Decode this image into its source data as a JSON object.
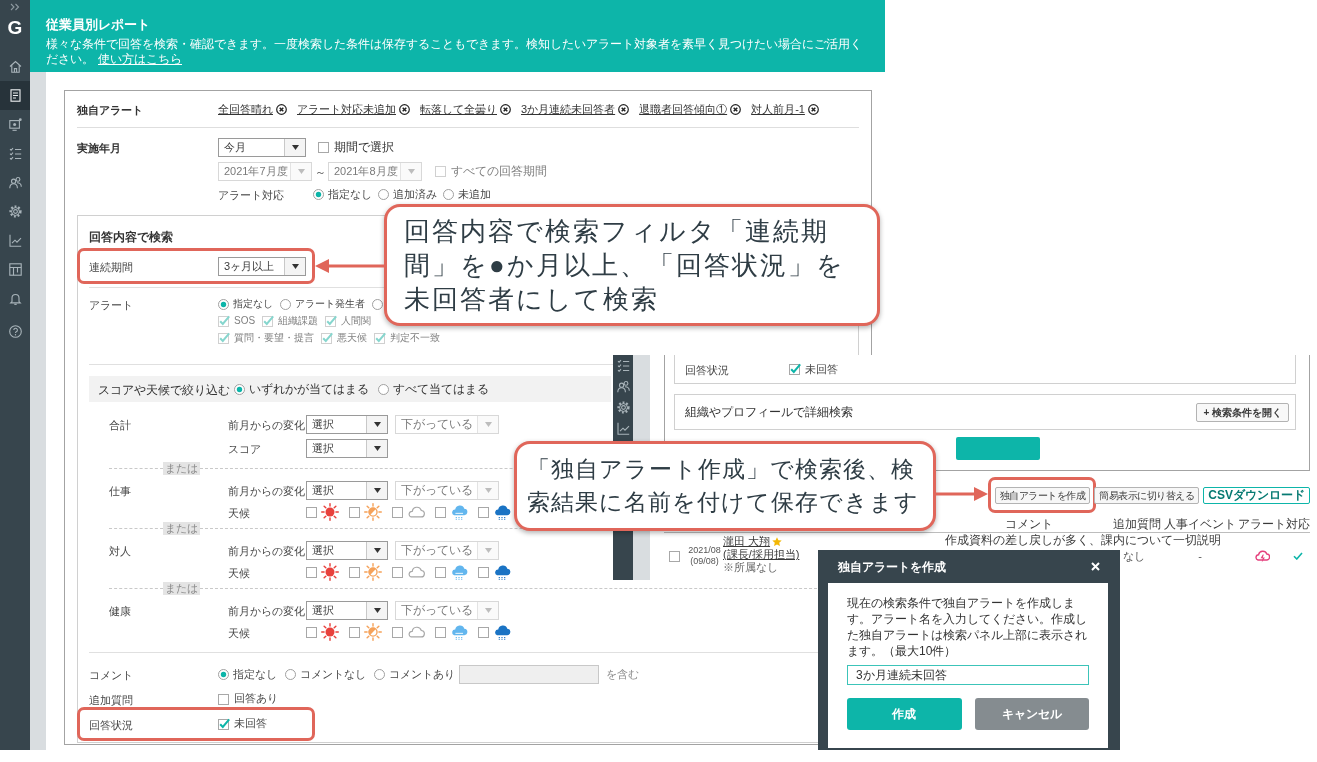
{
  "sidebar": {
    "logo": "G",
    "items": [
      {
        "selected": false
      },
      {
        "selected": true
      },
      {
        "selected": false
      },
      {
        "selected": false
      },
      {
        "selected": false
      },
      {
        "selected": false
      },
      {
        "selected": false
      },
      {
        "selected": false
      },
      {
        "selected": false
      },
      {
        "selected": false
      }
    ]
  },
  "header": {
    "title": "従業員別レポート",
    "description": "様々な条件で回答を検索・確認できます。一度検索した条件は保存することもできます。検知したいアラート対象者を素早く見つけたい場合にご活用ください。",
    "help_link": "使い方はこちら"
  },
  "filters": {
    "custom_alerts": {
      "label": "独自アラート",
      "items": [
        "全回答晴れ",
        "アラート対応未追加",
        "転落して全曇り",
        "3か月連続未回答者",
        "退職者回答傾向①",
        "対人前月-1"
      ]
    },
    "period": {
      "label": "実施年月",
      "month": {
        "value": "今月",
        "disabled": false
      },
      "range": {
        "label": "期間で選択",
        "checked": false,
        "disabled": false
      },
      "from": {
        "value": "2021年7月度",
        "disabled": true
      },
      "separator": "～",
      "to": {
        "value": "2021年8月度",
        "disabled": true
      },
      "all": {
        "label": "すべての回答期間",
        "checked": false,
        "disabled": true
      },
      "alert_action": {
        "label": "アラート対応",
        "options": [
          {
            "label": "指定なし",
            "selected": true
          },
          {
            "label": "追加済み",
            "selected": false
          },
          {
            "label": "未追加",
            "selected": false
          }
        ]
      }
    },
    "answer_search": {
      "title": "回答内容で検索",
      "streak": {
        "label": "連続期間",
        "value": "3ヶ月以上",
        "highlighted": true
      },
      "alert": {
        "label": "アラート",
        "options": [
          {
            "label": "指定なし",
            "selected": true
          },
          {
            "label": "アラート発生者",
            "selected": false
          },
          {
            "selected": false
          }
        ],
        "types": [
          [
            {
              "label": "SOS",
              "checked": true,
              "disabled": true
            },
            {
              "label": "組織課題",
              "checked": true,
              "disabled": true
            },
            {
              "label": "人間関",
              "checked": true,
              "disabled": true
            }
          ],
          [
            {
              "label": "質問・要望・提言",
              "checked": true,
              "disabled": true
            },
            {
              "label": "悪天候",
              "checked": true,
              "disabled": true
            },
            {
              "label": "判定不一致",
              "checked": true,
              "disabled": true
            }
          ]
        ]
      },
      "score": {
        "label": "スコアや天候で絞り込む",
        "options": [
          {
            "label": "いずれかが当てはまる",
            "selected": true
          },
          {
            "label": "すべて当てはまる",
            "selected": false
          }
        ]
      },
      "categories": [
        {
          "name": "合計",
          "rows": [
            {
              "kind": "change",
              "label": "前月からの変化",
              "value": "選択",
              "direction": {
                "value": "下がっている",
                "disabled": true
              }
            },
            {
              "kind": "score",
              "label": "スコア",
              "value": "選択"
            }
          ]
        },
        {
          "separator": "または",
          "name": "仕事",
          "rows": [
            {
              "kind": "change",
              "label": "前月からの変化",
              "value": "選択",
              "direction": {
                "value": "下がっている",
                "disabled": true
              }
            },
            {
              "kind": "weather",
              "label": "天候",
              "options": [
                {
                  "checked": false
                },
                {
                  "checked": false
                },
                {
                  "checked": false
                },
                {
                  "checked": false
                },
                {
                  "checked": false
                }
              ]
            }
          ]
        },
        {
          "separator": "または",
          "name": "対人",
          "rows": [
            {
              "kind": "change",
              "label": "前月からの変化",
              "value": "選択",
              "direction": {
                "value": "下がっている",
                "disabled": true
              }
            },
            {
              "kind": "weather",
              "label": "天候",
              "options": [
                {
                  "checked": false
                },
                {
                  "checked": false
                },
                {
                  "checked": false
                },
                {
                  "checked": false
                },
                {
                  "checked": false
                }
              ]
            }
          ]
        },
        {
          "separator": "または",
          "name": "健康",
          "rows": [
            {
              "kind": "change",
              "label": "前月からの変化",
              "value": "選択",
              "direction": {
                "value": "下がっている",
                "disabled": true
              }
            },
            {
              "kind": "weather",
              "label": "天候",
              "options": [
                {
                  "checked": false
                },
                {
                  "checked": false
                },
                {
                  "checked": false
                },
                {
                  "checked": false
                },
                {
                  "checked": false
                }
              ]
            }
          ]
        }
      ],
      "comment": {
        "label": "コメント",
        "options": [
          {
            "label": "指定なし",
            "selected": true
          },
          {
            "label": "コメントなし",
            "selected": false
          },
          {
            "label": "コメントあり",
            "selected": false
          }
        ],
        "input": {
          "disabled": true
        },
        "suffix": "を含む"
      },
      "extra_question": {
        "label": "追加質問",
        "check": {
          "label": "回答あり",
          "checked": false
        }
      },
      "status": {
        "label": "回答状況",
        "check": {
          "label": "未回答",
          "checked": true
        },
        "highlighted": true
      }
    }
  },
  "results_screen": {
    "sidebar_items": [
      {
        "selected": false
      },
      {
        "selected": false
      },
      {
        "selected": false
      },
      {
        "selected": false
      }
    ],
    "answer_status": {
      "label": "回答状況",
      "check": {
        "label": "未回答",
        "checked": true
      }
    },
    "detail_search": {
      "label": "組織やプロフィールで詳細検索",
      "button": "+ 検索条件を開く"
    },
    "search_button": {
      "kind": "primary"
    },
    "actions": [
      {
        "label": "独自アラートを作成",
        "kind": "plain",
        "highlighted": true
      },
      {
        "label": "簡易表示に切り替える",
        "kind": "plain",
        "highlighted": false
      },
      {
        "label": "CSVダウンロード",
        "kind": "accent",
        "highlighted": false
      }
    ],
    "columns": [
      "コメント",
      "追加質問",
      "人事イベント",
      "アラート",
      "対応"
    ],
    "rows": [
      {
        "checked": false,
        "date": "2021/08",
        "date_note": "(09/08)",
        "name": "瀧田 大翔",
        "starred": true,
        "role": "(課長/採用担当)",
        "department": "※所属なし",
        "comment": "作成資料の差し戻しが多く、課内について一切説明",
        "extra": "なし",
        "hr_event": "-",
        "alert": true,
        "handled": true
      }
    ]
  },
  "dialog": {
    "title": "独自アラートを作成",
    "message": "現在の検索条件で独自アラートを作成します。アラート名を入力してください。作成した独自アラートは検索パネル上部に表示されます。（最大10件）",
    "input": {
      "value": "3か月連続未回答"
    },
    "buttons": [
      {
        "label": "作成",
        "kind": "primary"
      },
      {
        "label": "キャンセル",
        "kind": "secondary"
      }
    ]
  },
  "callouts": [
    {
      "text": "回答内容で検索フィルタ「連続期間」を●か月以上、「回答状況」を未回答者にして検索"
    },
    {
      "text": "「独自アラート作成」で検索後、検索結果に名前を付けて保存できます"
    }
  ]
}
